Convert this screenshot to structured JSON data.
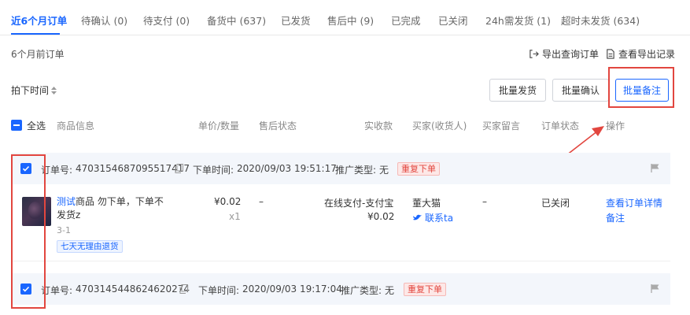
{
  "tabs": [
    {
      "label": "近6个月订单"
    },
    {
      "label": "待确认 (0)"
    },
    {
      "label": "待支付 (0)"
    },
    {
      "label": "备货中 (637)"
    },
    {
      "label": "已发货"
    },
    {
      "label": "售后中 (9)"
    },
    {
      "label": "已完成"
    },
    {
      "label": "已关闭"
    },
    {
      "label": "24h需发货 (1)"
    },
    {
      "label": "超时未发货 (634)"
    }
  ],
  "section": {
    "label": "6个月前订单"
  },
  "toolbar": {
    "export_query": "导出查询订单",
    "view_export": "查看导出记录",
    "sort_label": "拍下时间",
    "batch_ship": "批量发货",
    "batch_confirm": "批量确认",
    "batch_note": "批量备注"
  },
  "columns": {
    "select_all": "全选",
    "product": "商品信息",
    "price_qty": "单价/数量",
    "after_sale": "售后状态",
    "paid": "实收款",
    "buyer": "买家(收货人)",
    "buyer_note": "买家留言",
    "status": "订单状态",
    "actions": "操作"
  },
  "orders": [
    {
      "order_no_label": "订单号:",
      "order_no": "4703154687095517417",
      "time_label": "下单时间:",
      "time": "2020/09/03 19:51:17",
      "promo_label": "推广类型:",
      "promo": "无",
      "tag": "重复下单",
      "product_prefix": "测试",
      "product_rest": "商品 勿下单，下单不发货z",
      "sku": "3-1",
      "service_tag": "七天无理由退货",
      "unit_price": "¥0.02",
      "qty": "x1",
      "after_sale": "–",
      "pay_method": "在线支付-支付宝",
      "paid": "¥0.02",
      "buyer_name": "董大猫",
      "contact": "联系ta",
      "buyer_note": "–",
      "status": "已关闭",
      "action_detail": "查看订单详情",
      "action_note": "备注"
    },
    {
      "order_no_label": "订单号:",
      "order_no": "4703145448624620274",
      "time_label": "下单时间:",
      "time": "2020/09/03 19:17:04",
      "promo_label": "推广类型:",
      "promo": "无",
      "tag": "重复下单"
    }
  ],
  "colors": {
    "accent": "#1966ff",
    "danger": "#e2463f",
    "row_bg": "#f3f6fb"
  },
  "icons": [
    "export-icon",
    "document-icon",
    "sort-icon",
    "checkbox-check-icon",
    "copy-icon",
    "flag-icon",
    "contact-bird-icon"
  ]
}
